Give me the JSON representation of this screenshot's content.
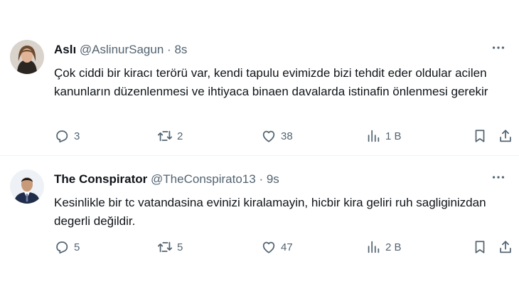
{
  "tweets": [
    {
      "name": "Aslı",
      "handle": "@AslinurSagun",
      "dot": "·",
      "time": "8s",
      "text": "Çok ciddi bir kiracı terörü var, kendi tapulu evimizde bizi tehdit eder oldular acilen kanunların düzenlenmesi ve ihtiyaca binaen davalarda istinafin önlenmesi gerekir",
      "replies": "3",
      "retweets": "2",
      "likes": "38",
      "views": "1 B"
    },
    {
      "name": "The Conspirator",
      "handle": "@TheConspirato13",
      "dot": "·",
      "time": "9s",
      "text": "Kesinlikle bir tc vatandasina evinizi kiralamayin, hicbir kira geliri ruh sagliginizdan degerli değildir.",
      "replies": "5",
      "retweets": "5",
      "likes": "47",
      "views": "2 B"
    }
  ],
  "colors": {
    "text": "#0f1419",
    "secondary": "#536471",
    "divider": "#eff3f4"
  },
  "icons": [
    "more-icon",
    "reply-icon",
    "retweet-icon",
    "like-icon",
    "views-icon",
    "bookmark-icon",
    "share-icon"
  ]
}
